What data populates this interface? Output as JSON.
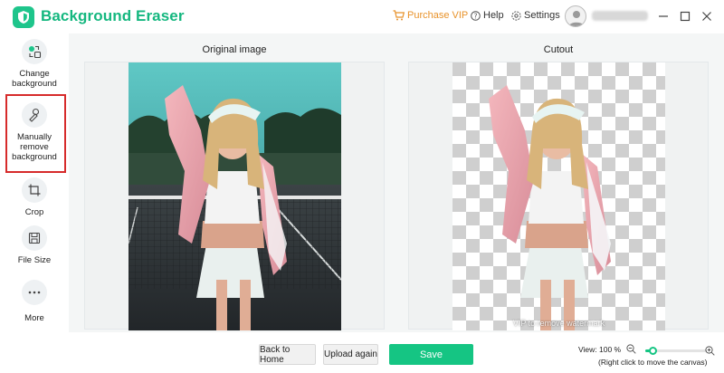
{
  "app": {
    "title": "Background Eraser",
    "brand_color": "#14b77f"
  },
  "header": {
    "purchase_vip": "Purchase VIP",
    "help": "Help",
    "settings": "Settings",
    "vip_color": "#e8922a"
  },
  "sidebar": {
    "items": [
      {
        "label": "Change\nbackground",
        "icon": "change-background-icon"
      },
      {
        "label": "Manually\nremove\nbackground",
        "icon": "brush-icon"
      },
      {
        "label": "Crop",
        "icon": "crop-icon"
      },
      {
        "label": "File Size",
        "icon": "save-file-icon"
      },
      {
        "label": "More",
        "icon": "more-dots-icon"
      }
    ],
    "highlight_color": "#d62b2b"
  },
  "main": {
    "original_title": "Original image",
    "cutout_title": "Cutout",
    "watermark": "VIP to remove watermark"
  },
  "bottom": {
    "back_home": "Back to Home",
    "upload_again": "Upload again",
    "save": "Save",
    "save_color": "#15c583",
    "zoom_label": "View: 100 %",
    "zoom_hint": "(Right click to move the canvas)",
    "zoom_level": 0.12
  }
}
